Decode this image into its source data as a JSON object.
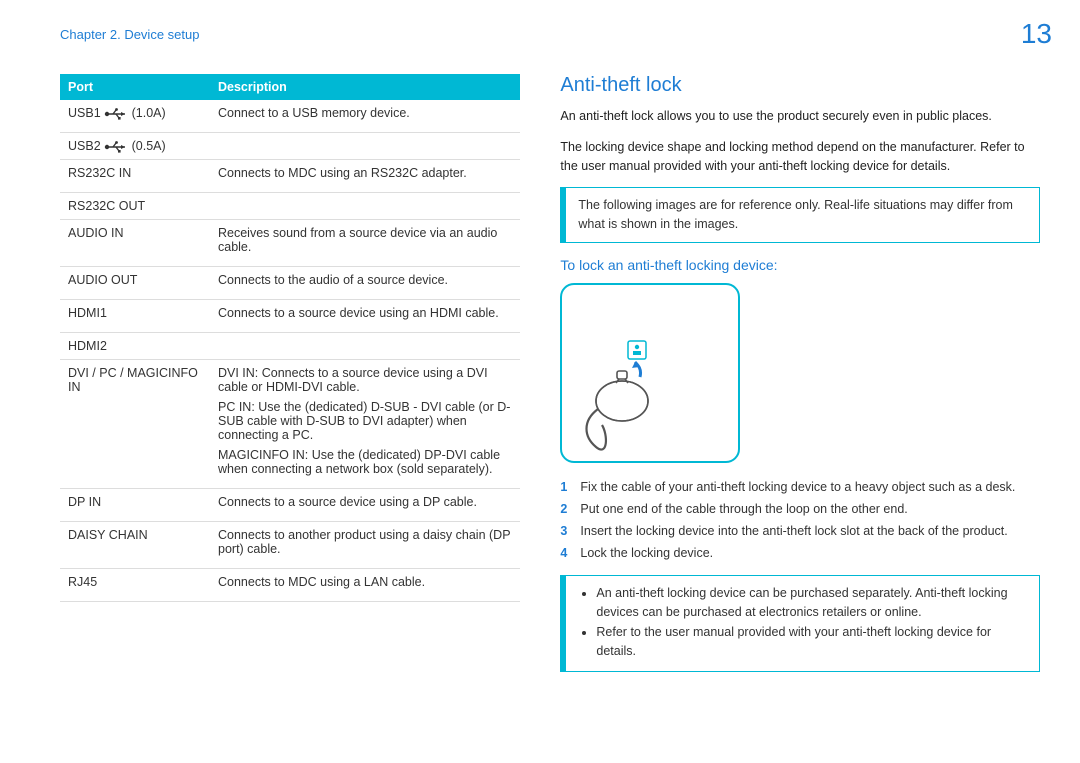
{
  "header": {
    "chapter": "Chapter 2. Device setup",
    "page_number": "13"
  },
  "ports_table": {
    "col_port": "Port",
    "col_desc": "Description",
    "rows": [
      {
        "port": "USB1",
        "suffix": "(1.0A)",
        "icon": true,
        "desc": "Connect to a USB memory device."
      },
      {
        "port": "USB2",
        "suffix": "(0.5A)",
        "icon": true,
        "desc": ""
      },
      {
        "port": "RS232C IN",
        "suffix": "",
        "icon": false,
        "desc": "Connects to MDC using an RS232C adapter."
      },
      {
        "port": "RS232C OUT",
        "suffix": "",
        "icon": false,
        "desc": ""
      },
      {
        "port": "AUDIO IN",
        "suffix": "",
        "icon": false,
        "desc": "Receives sound from a source device via an audio cable."
      },
      {
        "port": "AUDIO OUT",
        "suffix": "",
        "icon": false,
        "desc": "Connects to the audio of a source device."
      },
      {
        "port": "HDMI1",
        "suffix": "",
        "icon": false,
        "desc": "Connects to a source device using an HDMI cable."
      },
      {
        "port": "HDMI2",
        "suffix": "",
        "icon": false,
        "desc": ""
      },
      {
        "port": "DVI / PC / MAGICINFO IN",
        "suffix": "",
        "icon": false,
        "desc": "DVI IN: Connects to a source device using a DVI cable or HDMI-DVI cable.",
        "desc2": "PC IN: Use the (dedicated) D-SUB - DVI cable (or D-SUB cable with D-SUB to DVI adapter) when connecting a PC.",
        "desc3": "MAGICINFO IN: Use the (dedicated) DP-DVI cable when connecting a network box (sold separately)."
      },
      {
        "port": "DP IN",
        "suffix": "",
        "icon": false,
        "desc": "Connects to a source device using a DP cable."
      },
      {
        "port": "DAISY CHAIN",
        "suffix": "",
        "icon": false,
        "desc": "Connects to another product using a daisy chain (DP port) cable."
      },
      {
        "port": "RJ45",
        "suffix": "",
        "icon": false,
        "desc": "Connects to MDC using a LAN cable."
      }
    ]
  },
  "anti_theft": {
    "title": "Anti-theft lock",
    "intro1": "An anti-theft lock allows you to use the product securely even in public places.",
    "intro2": "The locking device shape and locking method depend on the manufacturer. Refer to the user manual provided with your anti-theft locking device for details.",
    "note1": "The following images are for reference only. Real-life situations may differ from what is shown in the images.",
    "sub_title": "To lock an anti-theft locking device:",
    "steps": [
      "Fix the cable of your anti-theft locking device to a heavy object such as a desk.",
      "Put one end of the cable through the loop on the other end.",
      "Insert the locking device into the anti-theft lock slot at the back of the product.",
      "Lock the locking device."
    ],
    "note2_items": [
      "An anti-theft locking device can be purchased separately. Anti-theft locking devices can be purchased at electronics retailers or online.",
      "Refer to the user manual provided with your anti-theft locking device for details."
    ]
  }
}
